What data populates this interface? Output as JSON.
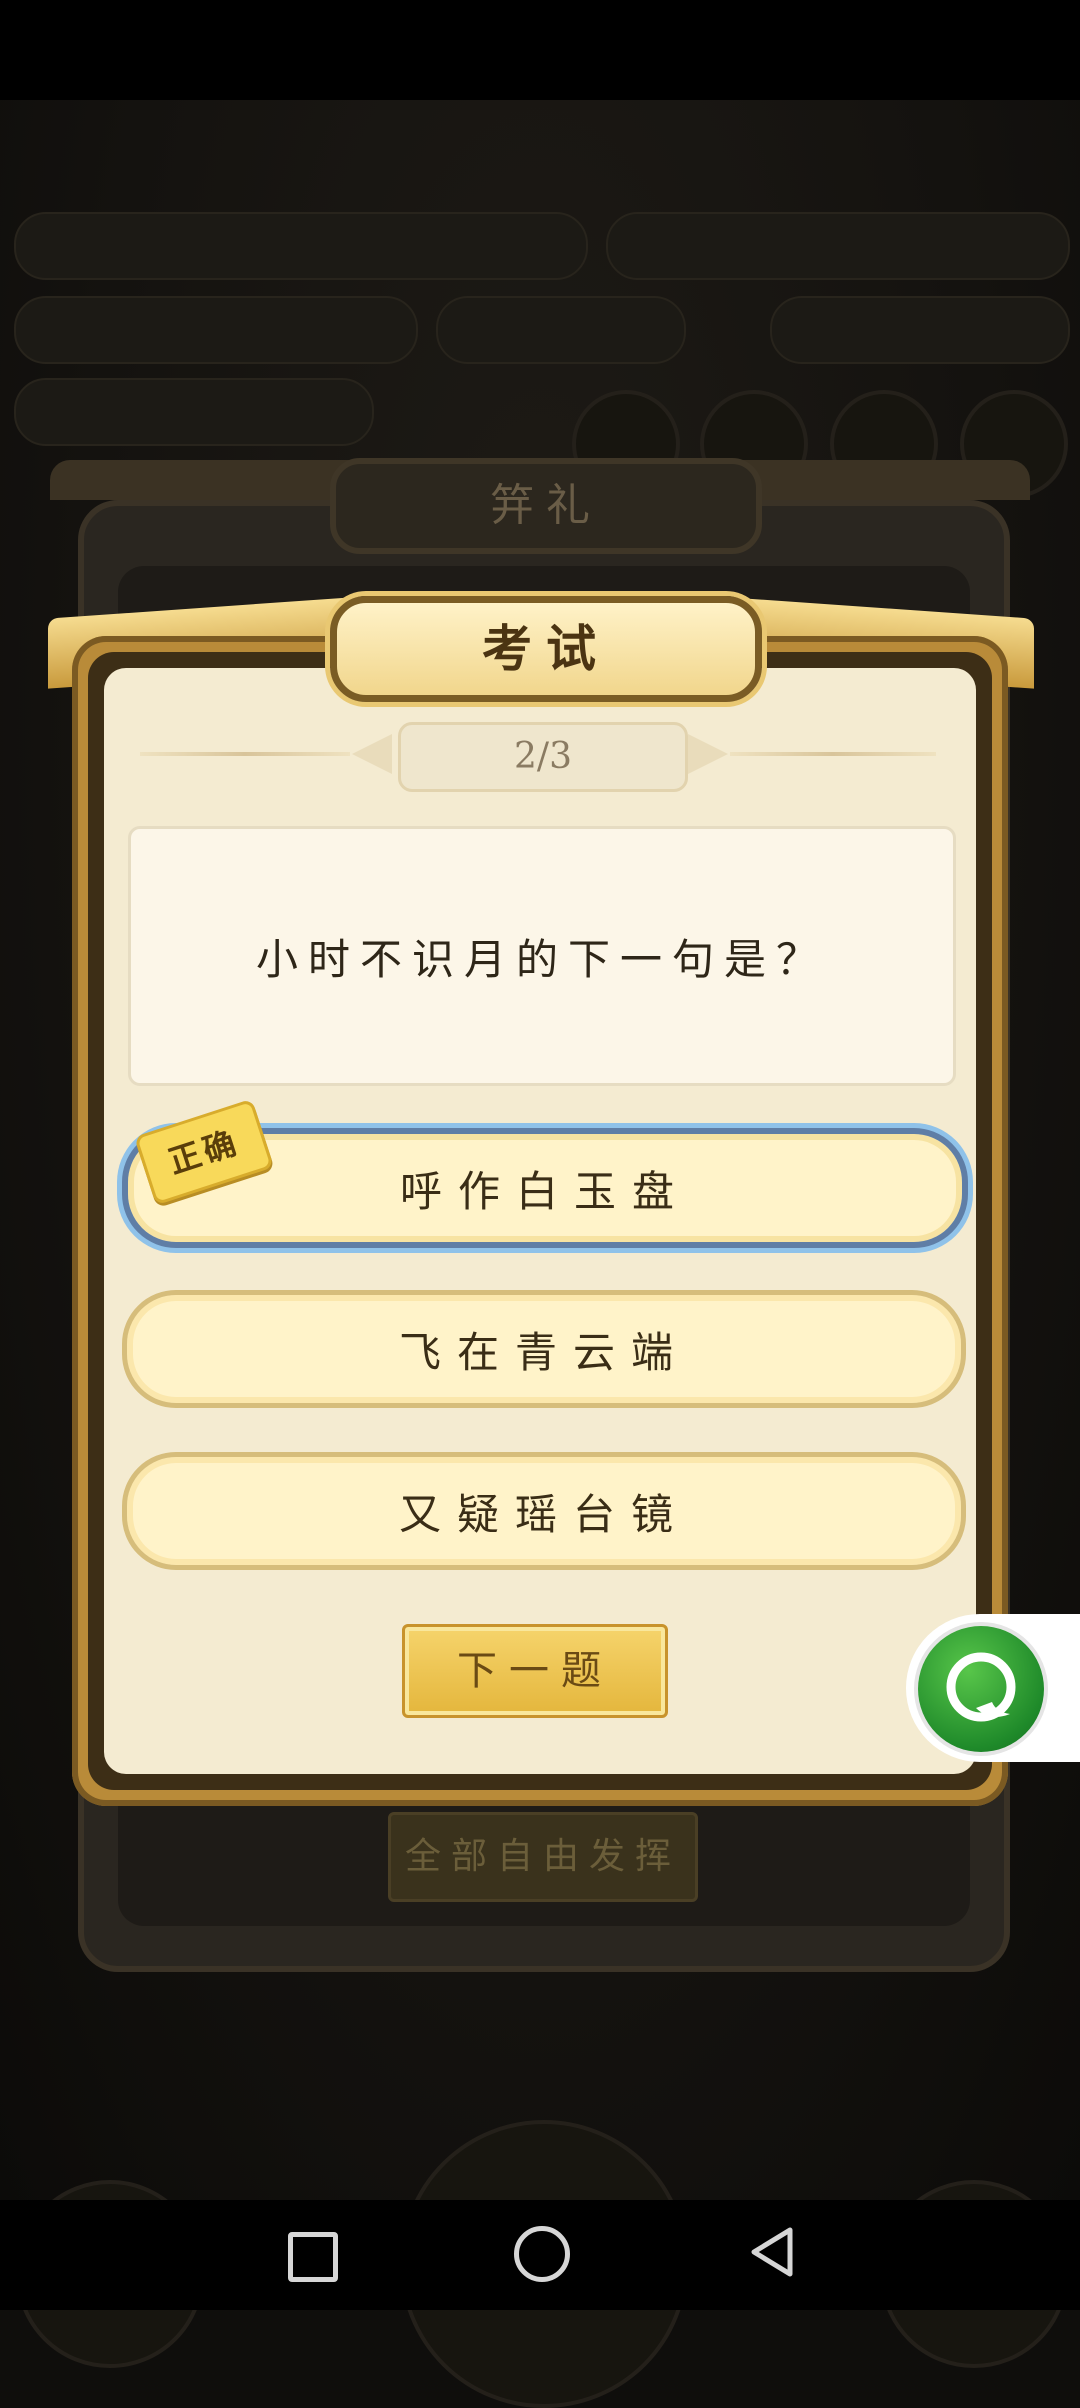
{
  "background": {
    "panel_title": "笄礼",
    "bottom_button": "全部自由发挥"
  },
  "dialog": {
    "title": "考试",
    "progress": "2/3",
    "question": "小时不识月的下一句是？",
    "options": [
      {
        "label": "呼作白玉盘",
        "selected": true
      },
      {
        "label": "飞在青云端",
        "selected": false
      },
      {
        "label": "又疑瑶台镜",
        "selected": false
      }
    ],
    "correct_badge": "正确",
    "next_button": "下一题"
  },
  "colors": {
    "dialog_border": "#b98b39",
    "paper": "#f4ebd1",
    "selected_outline": "#8fc2e9",
    "next_button": "#e4b63c",
    "floating_ball": "#1f8a2a"
  },
  "icons": {
    "floating": "chat-bubble-icon",
    "nav": [
      "recent-apps-icon",
      "home-icon",
      "back-icon"
    ]
  }
}
